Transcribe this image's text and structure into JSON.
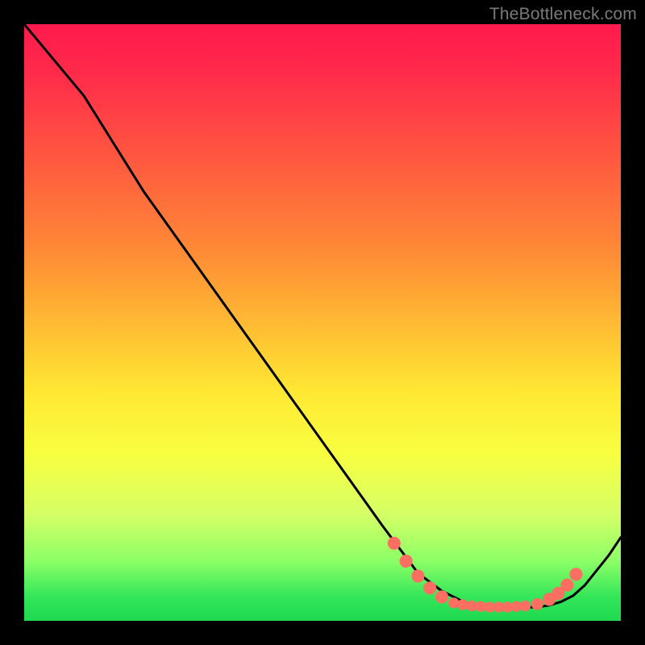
{
  "watermark": "TheBottleneck.com",
  "chart_data": {
    "type": "line",
    "title": "",
    "xlabel": "",
    "ylabel": "",
    "xlim": [
      0,
      100
    ],
    "ylim": [
      0,
      100
    ],
    "grid": false,
    "legend": false,
    "background_gradient": {
      "direction": "vertical",
      "stops": [
        {
          "pos": 0.0,
          "color": "#ff1a4d"
        },
        {
          "pos": 0.22,
          "color": "#ff5640"
        },
        {
          "pos": 0.52,
          "color": "#ffc233"
        },
        {
          "pos": 0.72,
          "color": "#f8ff40"
        },
        {
          "pos": 0.9,
          "color": "#8cff66"
        },
        {
          "pos": 1.0,
          "color": "#1fd94f"
        }
      ]
    },
    "series": [
      {
        "name": "bottleneck-curve",
        "color": "#000000",
        "x": [
          0,
          5,
          10,
          15,
          20,
          25,
          30,
          35,
          40,
          45,
          50,
          55,
          60,
          63,
          66,
          70,
          74,
          78,
          82,
          86,
          88,
          90,
          92,
          94,
          96,
          98,
          100
        ],
        "y": [
          100,
          94,
          88,
          80,
          72,
          65,
          58,
          51,
          44,
          37,
          30,
          23,
          16,
          12,
          8,
          5,
          3,
          2.3,
          2.2,
          2.3,
          2.6,
          3.2,
          4.2,
          6.0,
          8.5,
          11,
          14
        ]
      }
    ],
    "markers": [
      {
        "name": "marker-dot",
        "x": 62,
        "y": 13,
        "r": 1.1,
        "color": "#ff6f61"
      },
      {
        "name": "marker-dot",
        "x": 64,
        "y": 10,
        "r": 1.1,
        "color": "#ff6f61"
      },
      {
        "name": "marker-dot",
        "x": 66,
        "y": 7.5,
        "r": 1.1,
        "color": "#ff6f61"
      },
      {
        "name": "marker-dot",
        "x": 68,
        "y": 5.5,
        "r": 1.1,
        "color": "#ff6f61"
      },
      {
        "name": "marker-dot",
        "x": 70,
        "y": 4.0,
        "r": 1.1,
        "color": "#ff6f61"
      },
      {
        "name": "marker-dot",
        "x": 72,
        "y": 3.0,
        "r": 0.9,
        "color": "#ff6f61"
      },
      {
        "name": "marker-dot",
        "x": 73.5,
        "y": 2.7,
        "r": 0.9,
        "color": "#ff6f61"
      },
      {
        "name": "marker-dot",
        "x": 75,
        "y": 2.5,
        "r": 0.9,
        "color": "#ff6f61"
      },
      {
        "name": "marker-dot",
        "x": 76.5,
        "y": 2.4,
        "r": 0.9,
        "color": "#ff6f61"
      },
      {
        "name": "marker-dot",
        "x": 78,
        "y": 2.3,
        "r": 0.9,
        "color": "#ff6f61"
      },
      {
        "name": "marker-dot",
        "x": 79.5,
        "y": 2.3,
        "r": 0.9,
        "color": "#ff6f61"
      },
      {
        "name": "marker-dot",
        "x": 81,
        "y": 2.3,
        "r": 0.9,
        "color": "#ff6f61"
      },
      {
        "name": "marker-dot",
        "x": 82.5,
        "y": 2.4,
        "r": 0.9,
        "color": "#ff6f61"
      },
      {
        "name": "marker-dot",
        "x": 84,
        "y": 2.5,
        "r": 0.9,
        "color": "#ff6f61"
      },
      {
        "name": "marker-dot",
        "x": 86,
        "y": 2.8,
        "r": 1.0,
        "color": "#ff6f61"
      },
      {
        "name": "marker-dot",
        "x": 88,
        "y": 3.6,
        "r": 1.1,
        "color": "#ff6f61"
      },
      {
        "name": "marker-dot",
        "x": 89.5,
        "y": 4.6,
        "r": 1.1,
        "color": "#ff6f61"
      },
      {
        "name": "marker-dot",
        "x": 91,
        "y": 6.0,
        "r": 1.1,
        "color": "#ff6f61"
      },
      {
        "name": "marker-dot",
        "x": 92.5,
        "y": 7.8,
        "r": 1.1,
        "color": "#ff6f61"
      }
    ]
  }
}
